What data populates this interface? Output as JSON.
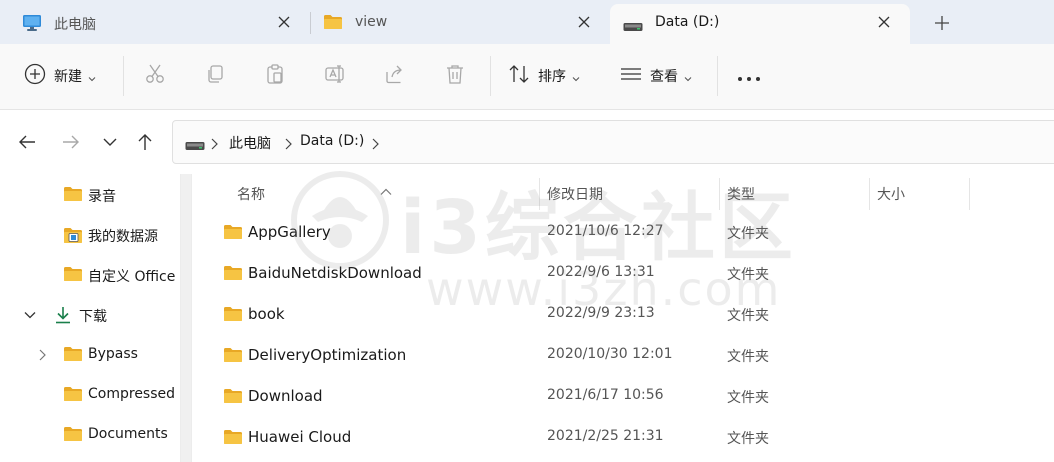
{
  "tabs": [
    {
      "label": "此电脑",
      "icon": "monitor-icon",
      "active": false
    },
    {
      "label": "view",
      "icon": "folder-icon",
      "active": false
    },
    {
      "label": "Data (D:)",
      "icon": "drive-icon",
      "active": true
    }
  ],
  "toolbar": {
    "new_label": "新建",
    "sort_label": "排序",
    "view_label": "查看",
    "icons": [
      "add-icon",
      "cut-icon",
      "copy-icon",
      "paste-icon",
      "rename-icon",
      "share-icon",
      "delete-icon",
      "sort-icon",
      "view-icon",
      "more-icon"
    ]
  },
  "address": {
    "segments": [
      "此电脑",
      "Data (D:)"
    ]
  },
  "sidebar": {
    "items": [
      {
        "label": "录音",
        "icon": "folder-icon"
      },
      {
        "label": "我的数据源",
        "icon": "datasource-folder-icon"
      },
      {
        "label": "自定义 Office",
        "icon": "folder-icon"
      },
      {
        "label": "下载",
        "icon": "download-icon",
        "expanded": true
      },
      {
        "label": "Bypass",
        "icon": "folder-icon"
      },
      {
        "label": "Compressed",
        "icon": "folder-icon"
      },
      {
        "label": "Documents",
        "icon": "folder-icon"
      }
    ]
  },
  "columns": {
    "name": "名称",
    "date": "修改日期",
    "type": "类型",
    "size": "大小"
  },
  "files": [
    {
      "name": "AppGallery",
      "date": "2021/10/6 12:27",
      "type": "文件夹"
    },
    {
      "name": "BaiduNetdiskDownload",
      "date": "2022/9/6 13:31",
      "type": "文件夹"
    },
    {
      "name": "book",
      "date": "2022/9/9 23:13",
      "type": "文件夹"
    },
    {
      "name": "DeliveryOptimization",
      "date": "2020/10/30 12:01",
      "type": "文件夹"
    },
    {
      "name": "Download",
      "date": "2021/6/17 10:56",
      "type": "文件夹"
    },
    {
      "name": "Huawei Cloud",
      "date": "2021/2/25 21:31",
      "type": "文件夹"
    }
  ],
  "watermark": {
    "text": "i3综合社区",
    "url": "www.i3zh.com"
  },
  "colors": {
    "folder": "#f6c443",
    "folder_dark": "#e8a825",
    "accent": "#1a7f4b",
    "tabstrip_bg": "#e9eef6"
  }
}
